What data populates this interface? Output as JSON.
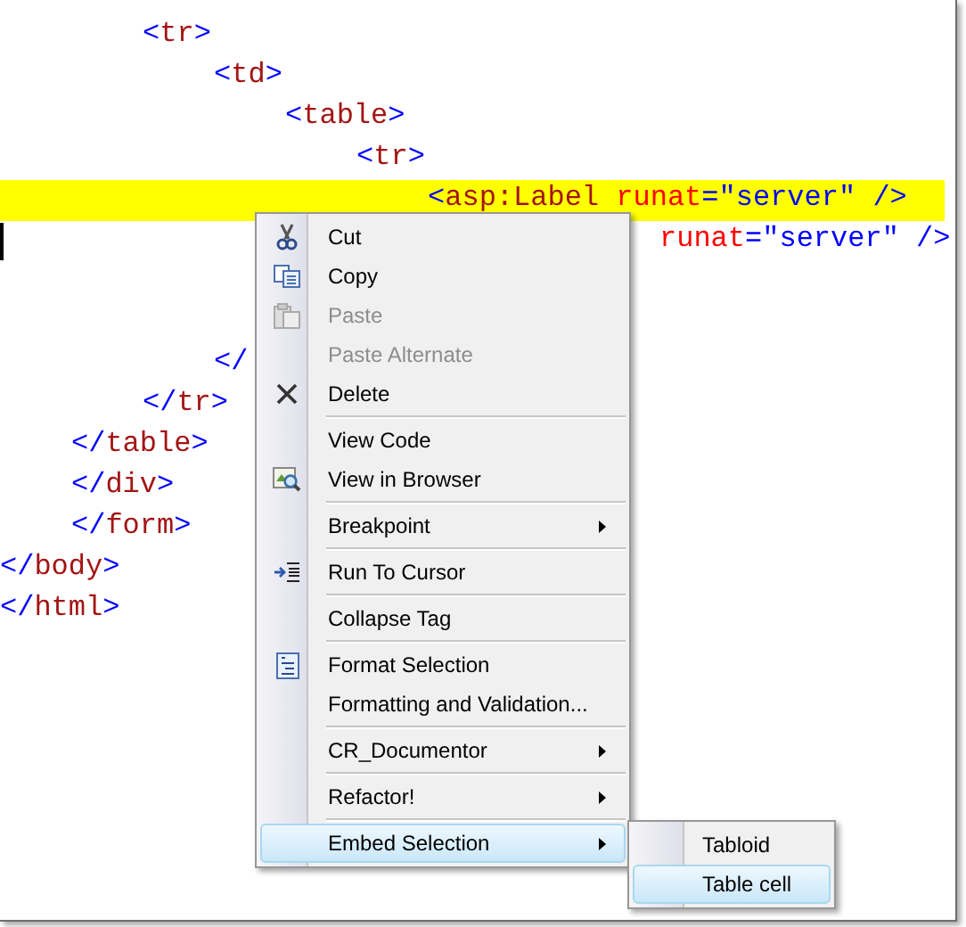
{
  "code_lines": [
    {
      "text": "        <tr>",
      "highlighted": false,
      "caret": false
    },
    {
      "text": "            <td>",
      "highlighted": false,
      "caret": false
    },
    {
      "text": "                <table>",
      "highlighted": false,
      "caret": false
    },
    {
      "text": "                    <tr>",
      "highlighted": false,
      "caret": false
    },
    {
      "text": "                        <asp:Label runat=\"server\" />",
      "highlighted": true,
      "caret": false
    },
    {
      "text": "                                     runat=\"server\" />",
      "highlighted": false,
      "caret": true
    },
    {
      "text": "            </",
      "highlighted": false,
      "caret": false
    },
    {
      "text": "        </tr>",
      "highlighted": false,
      "caret": false
    },
    {
      "text": "    </table>",
      "highlighted": false,
      "caret": false
    },
    {
      "text": "    </div>",
      "highlighted": false,
      "caret": false
    },
    {
      "text": "    </form>",
      "highlighted": false,
      "caret": false
    },
    {
      "text": "</body>",
      "highlighted": false,
      "caret": false
    },
    {
      "text": "</html>",
      "highlighted": false,
      "caret": false
    }
  ],
  "context_menu": {
    "groups": [
      [
        {
          "label": "Cut",
          "disabled": false,
          "submenu": false,
          "selected": false
        },
        {
          "label": "Copy",
          "disabled": false,
          "submenu": false,
          "selected": false
        },
        {
          "label": "Paste",
          "disabled": true,
          "submenu": false,
          "selected": false
        },
        {
          "label": "Paste Alternate",
          "disabled": true,
          "submenu": false,
          "selected": false
        },
        {
          "label": "Delete",
          "disabled": false,
          "submenu": false,
          "selected": false
        }
      ],
      [
        {
          "label": "View Code",
          "disabled": false,
          "submenu": false,
          "selected": false
        },
        {
          "label": "View in Browser",
          "disabled": false,
          "submenu": false,
          "selected": false
        }
      ],
      [
        {
          "label": "Breakpoint",
          "disabled": false,
          "submenu": true,
          "selected": false
        }
      ],
      [
        {
          "label": "Run To Cursor",
          "disabled": false,
          "submenu": false,
          "selected": false
        }
      ],
      [
        {
          "label": "Collapse Tag",
          "disabled": false,
          "submenu": false,
          "selected": false
        }
      ],
      [
        {
          "label": "Format Selection",
          "disabled": false,
          "submenu": false,
          "selected": false
        },
        {
          "label": "Formatting and Validation...",
          "disabled": false,
          "submenu": false,
          "selected": false
        }
      ],
      [
        {
          "label": "CR_Documentor",
          "disabled": false,
          "submenu": true,
          "selected": false
        }
      ],
      [
        {
          "label": "Refactor!",
          "disabled": false,
          "submenu": true,
          "selected": false
        }
      ],
      [
        {
          "label": "Embed Selection",
          "disabled": false,
          "submenu": true,
          "selected": true
        }
      ]
    ]
  },
  "submenu": {
    "items": [
      {
        "label": "Tabloid",
        "selected": false
      },
      {
        "label": "Table cell",
        "selected": true
      }
    ]
  }
}
